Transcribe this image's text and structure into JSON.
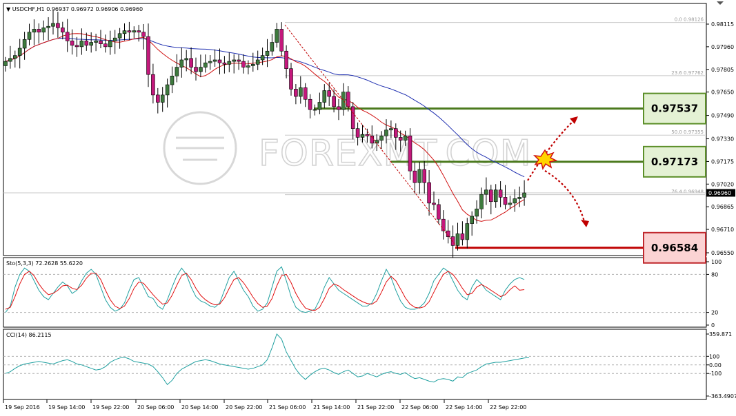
{
  "chart_data": [
    {
      "type": "candlestick",
      "title": "USDCHF,H1 0.96937 0.96972 0.96906 0.96960",
      "symbol": "USDCHF,H1",
      "ohlc_header": [
        "0.96937",
        "0.96972",
        "0.96906",
        "0.96960"
      ],
      "current_price": 0.9696,
      "current_price_label": "0.96960",
      "y_range": [
        0.9655,
        0.9813
      ],
      "y_ticks": [
        "0.98115",
        "0.97960",
        "0.97805",
        "0.97650",
        "0.97490",
        "0.97330",
        "0.97175",
        "0.97020",
        "0.96865",
        "0.96710",
        "0.96550"
      ],
      "y_tick_values": [
        0.98115,
        0.9796,
        0.97805,
        0.9765,
        0.9749,
        0.9733,
        0.97175,
        0.9702,
        0.96865,
        0.9671,
        0.9655
      ],
      "x_labels": [
        "19 Sep 2016",
        "19 Sep 14:00",
        "19 Sep 22:00",
        "20 Sep 06:00",
        "20 Sep 14:00",
        "20 Sep 22:00",
        "21 Sep 06:00",
        "21 Sep 14:00",
        "21 Sep 22:00",
        "22 Sep 06:00",
        "22 Sep 14:00",
        "22 Sep 22:00"
      ],
      "candle_closes": [
        0.9786,
        0.9788,
        0.979,
        0.9795,
        0.9801,
        0.9806,
        0.9808,
        0.9806,
        0.9809,
        0.981,
        0.9812,
        0.9809,
        0.9806,
        0.98,
        0.9797,
        0.9796,
        0.98,
        0.9797,
        0.9799,
        0.98,
        0.9798,
        0.9796,
        0.98,
        0.9802,
        0.9805,
        0.9807,
        0.9806,
        0.9807,
        0.9806,
        0.9803,
        0.9777,
        0.9763,
        0.9758,
        0.9763,
        0.977,
        0.9776,
        0.9782,
        0.9787,
        0.9788,
        0.9782,
        0.9779,
        0.9782,
        0.9785,
        0.9786,
        0.9787,
        0.9785,
        0.9784,
        0.9786,
        0.9787,
        0.9786,
        0.9782,
        0.9783,
        0.9784,
        0.9787,
        0.979,
        0.9793,
        0.9799,
        0.9808,
        0.9793,
        0.9781,
        0.9767,
        0.9762,
        0.9768,
        0.976,
        0.9753,
        0.9753,
        0.9758,
        0.9766,
        0.9762,
        0.9755,
        0.9753,
        0.9765,
        0.9755,
        0.974,
        0.9734,
        0.9736,
        0.9735,
        0.973,
        0.9732,
        0.9735,
        0.9739,
        0.974,
        0.9734,
        0.9732,
        0.9735,
        0.9711,
        0.9703,
        0.9712,
        0.9703,
        0.9689,
        0.9688,
        0.9678,
        0.967,
        0.9666,
        0.966,
        0.9668,
        0.9664,
        0.9675,
        0.968,
        0.9685,
        0.9695,
        0.9698,
        0.969,
        0.9698,
        0.9693,
        0.9688,
        0.9689,
        0.9692,
        0.9693,
        0.9696
      ],
      "fibonacci_levels": [
        {
          "label": "0.0 0.98126",
          "value": 0.98126
        },
        {
          "label": "23.6 0.97762",
          "value": 0.97762
        },
        {
          "label": "50.0 0.97355",
          "value": 0.97355
        },
        {
          "label": "76.4 0.96948",
          "value": 0.96948
        }
      ],
      "levels": [
        {
          "label": "0.97537",
          "value": 0.97537,
          "role": "resistance",
          "color": "#4b7a1e",
          "box_fill": "#e4f1d4",
          "box_border": "#5b8f28"
        },
        {
          "label": "0.97173",
          "value": 0.97173,
          "role": "pivot",
          "color": "#4b7a1e",
          "box_fill": "#e4f1d4",
          "box_border": "#5b8f28"
        },
        {
          "label": "0.96584",
          "value": 0.96584,
          "role": "support",
          "color": "#c00000",
          "box_fill": "#fbd3d3",
          "box_border": "#c0282d"
        }
      ],
      "moving_averages": [
        {
          "color": "#d01010"
        },
        {
          "color": "#1f2fb0"
        }
      ],
      "colors": {
        "bull": "#3e7a3e",
        "bear": "#c4187c",
        "arrow": "#c00000",
        "grid": "#c8c8c8"
      },
      "watermark": "FOREXMT.COM"
    },
    {
      "type": "line",
      "label": "Sto(5,3,3) 72.2628 55.6220",
      "y_range": [
        0,
        100
      ],
      "y_ticks": [
        "100",
        "80",
        "20",
        "0"
      ],
      "levels": [
        80,
        20
      ],
      "series": [
        {
          "color": "#20a0a0",
          "values": [
            20,
            30,
            60,
            80,
            90,
            85,
            70,
            55,
            45,
            40,
            50,
            60,
            68,
            62,
            50,
            55,
            70,
            82,
            88,
            80,
            60,
            40,
            28,
            22,
            25,
            35,
            55,
            72,
            75,
            60,
            45,
            42,
            30,
            25,
            40,
            60,
            78,
            90,
            80,
            60,
            45,
            38,
            35,
            30,
            28,
            35,
            55,
            75,
            85,
            70,
            55,
            45,
            30,
            22,
            25,
            35,
            60,
            85,
            92,
            70,
            45,
            28,
            22,
            20,
            22,
            25,
            40,
            60,
            75,
            65,
            55,
            50,
            45,
            40,
            35,
            30,
            30,
            35,
            50,
            70,
            88,
            75,
            55,
            38,
            28,
            25,
            25,
            28,
            35,
            50,
            70,
            80,
            90,
            85,
            70,
            55,
            45,
            40,
            60,
            72,
            65,
            55,
            50,
            45,
            40,
            55,
            65,
            72,
            75,
            72
          ]
        },
        {
          "color": "#e01010",
          "values": [
            25,
            28,
            45,
            65,
            80,
            85,
            78,
            65,
            55,
            48,
            50,
            55,
            62,
            63,
            58,
            56,
            63,
            74,
            82,
            82,
            72,
            55,
            40,
            30,
            26,
            30,
            42,
            58,
            68,
            66,
            57,
            48,
            40,
            33,
            35,
            47,
            63,
            78,
            82,
            72,
            58,
            47,
            40,
            35,
            32,
            33,
            43,
            58,
            72,
            75,
            67,
            56,
            44,
            34,
            28,
            30,
            42,
            62,
            78,
            80,
            67,
            50,
            37,
            27,
            24,
            23,
            28,
            42,
            58,
            65,
            62,
            56,
            51,
            46,
            41,
            37,
            34,
            33,
            38,
            52,
            68,
            77,
            70,
            57,
            43,
            33,
            28,
            27,
            29,
            37,
            52,
            67,
            80,
            85,
            80,
            70,
            58,
            48,
            50,
            60,
            64,
            60,
            55,
            50,
            45,
            48,
            56,
            62,
            55,
            56
          ]
        }
      ]
    },
    {
      "type": "line",
      "label": "CCI(14) 86.2115",
      "y_range": [
        -363.4907,
        359.871
      ],
      "y_ticks": [
        "359.871",
        "100",
        "0.00",
        "-100",
        "-363.4907"
      ],
      "levels": [
        100,
        0,
        -100
      ],
      "series": [
        {
          "color": "#20a0a0",
          "values": [
            -100,
            -80,
            -40,
            -10,
            10,
            20,
            30,
            40,
            30,
            20,
            10,
            30,
            50,
            60,
            40,
            10,
            0,
            -20,
            -40,
            -60,
            -50,
            -20,
            30,
            60,
            80,
            90,
            70,
            40,
            30,
            20,
            10,
            -20,
            -80,
            -150,
            -230,
            -180,
            -100,
            -50,
            -20,
            10,
            40,
            50,
            60,
            50,
            30,
            10,
            0,
            -10,
            -20,
            -30,
            -40,
            -50,
            -40,
            -20,
            0,
            60,
            200,
            360,
            300,
            150,
            50,
            -50,
            -120,
            -170,
            -120,
            -80,
            -50,
            -40,
            -60,
            -90,
            -110,
            -80,
            -60,
            -100,
            -140,
            -130,
            -100,
            -120,
            -140,
            -110,
            -90,
            -80,
            -100,
            -110,
            -90,
            -130,
            -160,
            -150,
            -170,
            -190,
            -200,
            -170,
            -160,
            -170,
            -190,
            -140,
            -150,
            -100,
            -80,
            -60,
            -20,
            10,
            20,
            30,
            30,
            40,
            50,
            60,
            70,
            80,
            86
          ]
        }
      ]
    }
  ]
}
